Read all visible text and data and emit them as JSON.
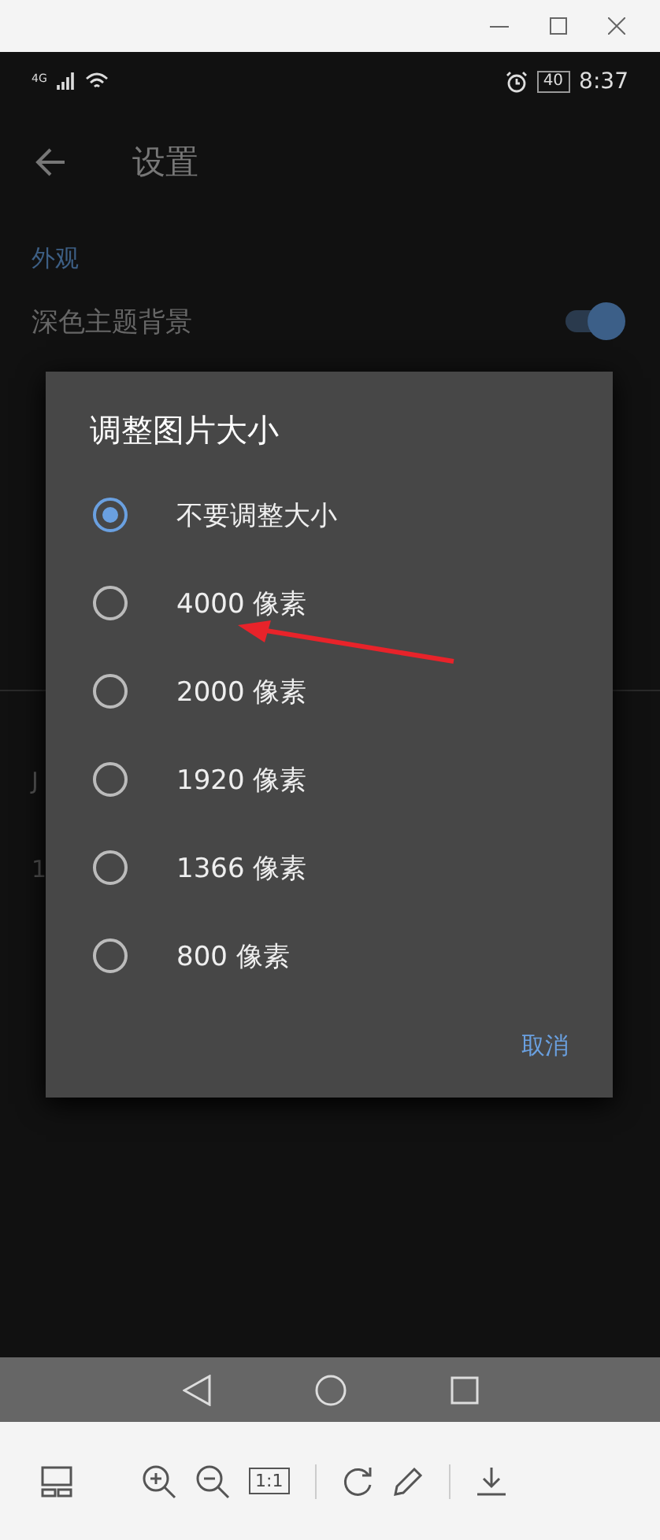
{
  "status_bar": {
    "network": "4G",
    "battery": "40",
    "time": "8:37"
  },
  "app_bar": {
    "title": "设置"
  },
  "settings": [
    {
      "kind": "header",
      "text": "外观"
    },
    {
      "kind": "toggle",
      "text": "深色主题背景",
      "on": true
    },
    {
      "kind": "divider"
    },
    {
      "kind": "item",
      "lines": [
        "J"
      ]
    },
    {
      "kind": "item",
      "lines": [
        "1"
      ]
    }
  ],
  "dialog": {
    "title": "调整图片大小",
    "options": [
      {
        "label": "不要调整大小",
        "selected": true
      },
      {
        "label": "4000 像素",
        "selected": false
      },
      {
        "label": "2000 像素",
        "selected": false
      },
      {
        "label": "1920 像素",
        "selected": false
      },
      {
        "label": "1366 像素",
        "selected": false
      },
      {
        "label": "800 像素",
        "selected": false
      }
    ],
    "cancel": "取消"
  },
  "toolbar": {
    "actual_size": "1:1"
  }
}
